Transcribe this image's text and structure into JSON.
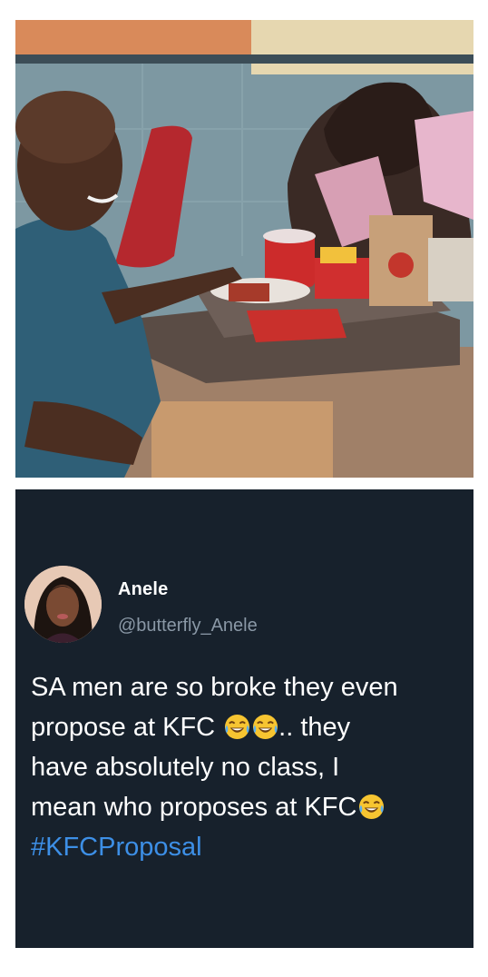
{
  "photo": {
    "icon": "proposal-photo-illustration"
  },
  "tweet": {
    "colors": {
      "background": "#17212c",
      "text": "#ffffff",
      "handle": "#8a98a6",
      "hashtag": "#3d8fe6"
    },
    "author": {
      "name": "Anele",
      "handle": "@butterfly_Anele",
      "avatar_icon": "profile-avatar"
    },
    "body": {
      "line1": "SA men are so broke they even",
      "line2_a": "propose at KFC ",
      "line2_b": ".. they",
      "line3": "have absolutely no class, I",
      "line4": "mean who proposes at KFC",
      "hashtag": "#KFCProposal",
      "emoji_icon": "face-with-tears-of-joy-emoji"
    }
  }
}
